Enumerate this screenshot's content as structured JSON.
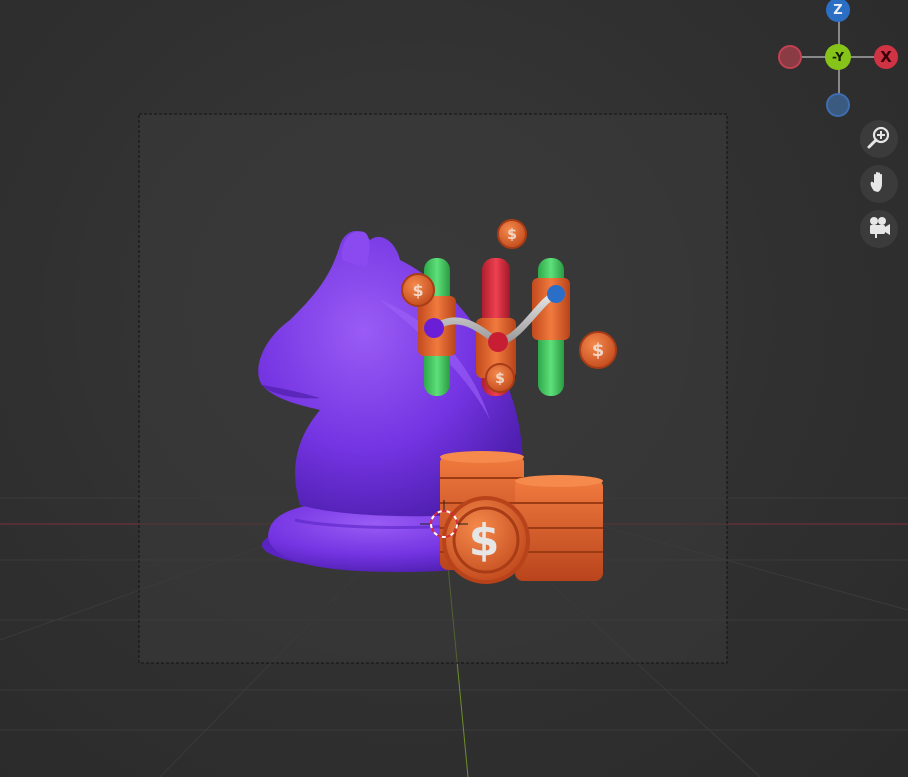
{
  "viewport": {
    "background": "#2f2f2f",
    "camera_frame_color": "#3a3a3a",
    "grid_x_axis_color": "#8a3b44",
    "grid_y_axis_color": "#6b8f2a"
  },
  "nav_gizmo": {
    "z_label": "Z",
    "view_label": "-Y",
    "x_label": "X",
    "colors": {
      "x": "#cf3344",
      "y": "#86c41a",
      "z": "#2b6fc4"
    }
  },
  "tools": [
    {
      "name": "zoom",
      "icon": "zoom-icon"
    },
    {
      "name": "pan",
      "icon": "hand-icon"
    },
    {
      "name": "camera",
      "icon": "camera-icon"
    }
  ],
  "scene": {
    "knight_color": "#7a36e6",
    "coin_color": "#e05a2a",
    "candle_colors": [
      "#3dc25a",
      "#d9283a",
      "#3dc25a"
    ],
    "coin_symbol": "$"
  }
}
